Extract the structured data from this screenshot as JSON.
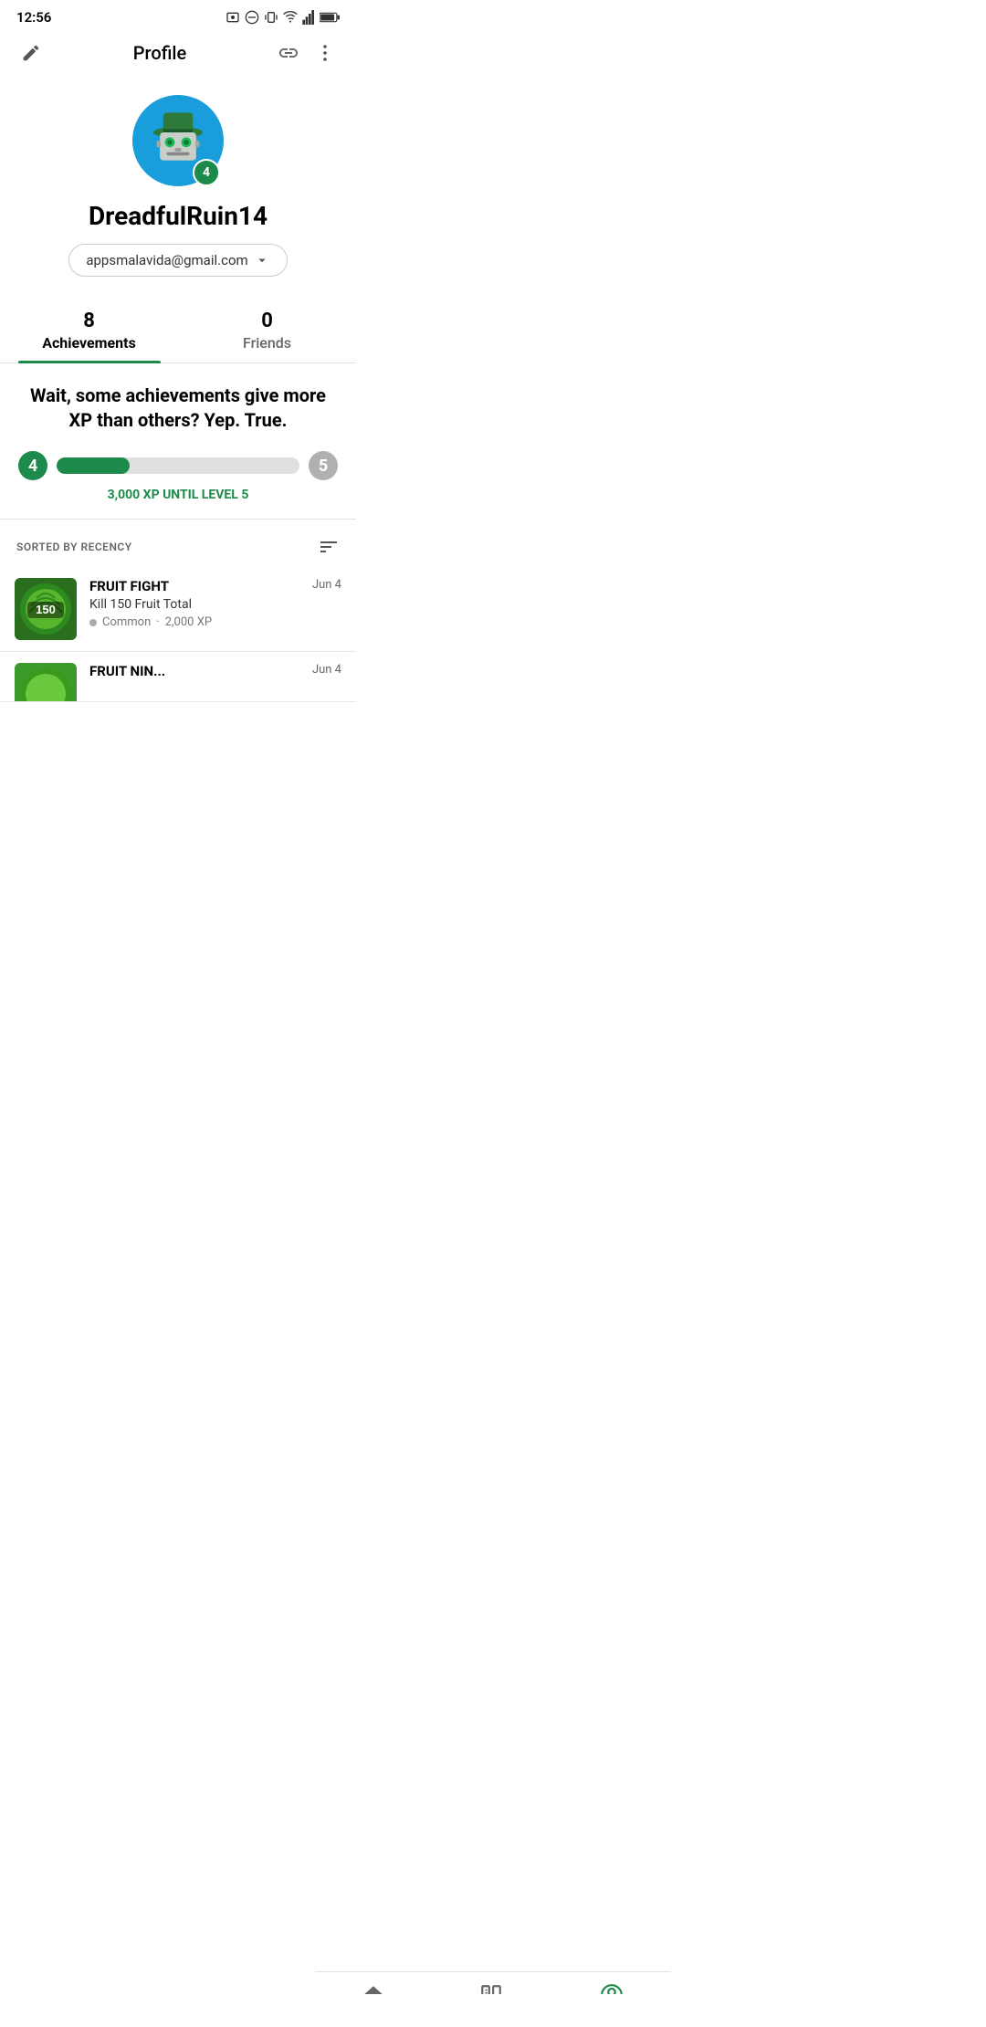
{
  "statusBar": {
    "time": "12:56",
    "icons": [
      "📳",
      "wifi",
      "signal",
      "battery"
    ]
  },
  "appBar": {
    "title": "Profile",
    "editIcon": "✏️",
    "linkIcon": "🔗",
    "moreIcon": "⋮"
  },
  "profile": {
    "username": "DreadfulRuin14",
    "email": "appsmalavida@gmail.com",
    "level": "4",
    "avatarAlt": "Robot avatar with green hat"
  },
  "tabs": [
    {
      "id": "achievements",
      "count": "8",
      "label": "Achievements",
      "active": true
    },
    {
      "id": "friends",
      "count": "0",
      "label": "Friends",
      "active": false
    }
  ],
  "xpSection": {
    "message": "Wait, some achievements give more XP than others? Yep. True.",
    "levelStart": "4",
    "levelEnd": "5",
    "fillPercent": "30",
    "xpNeeded": "3,000 XP",
    "untilLabel": "UNTIL LEVEL 5"
  },
  "achievementsHeader": {
    "sortedLabel": "SORTED BY RECENCY",
    "sortIconLabel": "sort"
  },
  "achievements": [
    {
      "title": "FRUIT FIGHT",
      "description": "Kill 150 Fruit Total",
      "rarity": "Common",
      "xp": "2,000 XP",
      "date": "Jun 4",
      "thumbBg": "#2d7a2a",
      "thumbText": "150"
    },
    {
      "title": "FRUIT NINJA",
      "description": "",
      "rarity": "",
      "xp": "",
      "date": "Jun 4",
      "thumbBg": "#3a9a2a",
      "thumbText": ""
    }
  ],
  "bottomNav": [
    {
      "id": "home",
      "label": "Home",
      "active": false,
      "icon": "home"
    },
    {
      "id": "library",
      "label": "Library",
      "active": false,
      "icon": "library"
    },
    {
      "id": "profile",
      "label": "Profile",
      "active": true,
      "icon": "profile"
    }
  ]
}
